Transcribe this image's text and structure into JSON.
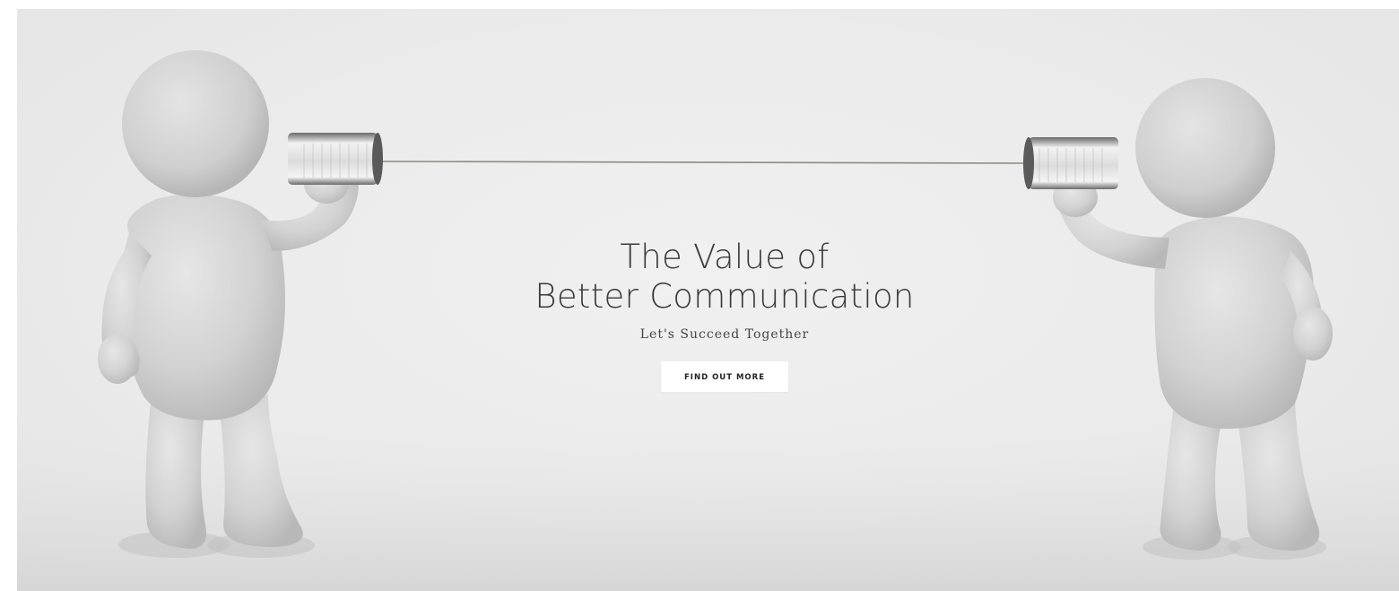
{
  "hero": {
    "title_line_1": "The Value of",
    "title_line_2": "Better Communication",
    "subtitle": "Let's Succeed Together",
    "button_label": "FIND OUT MORE",
    "image_subject": "two-figures-tin-can-telephone"
  },
  "colors": {
    "background": "#ececec",
    "figure": "#d4d4d4",
    "text": "#3a3a3a",
    "button_bg": "#ffffff"
  }
}
